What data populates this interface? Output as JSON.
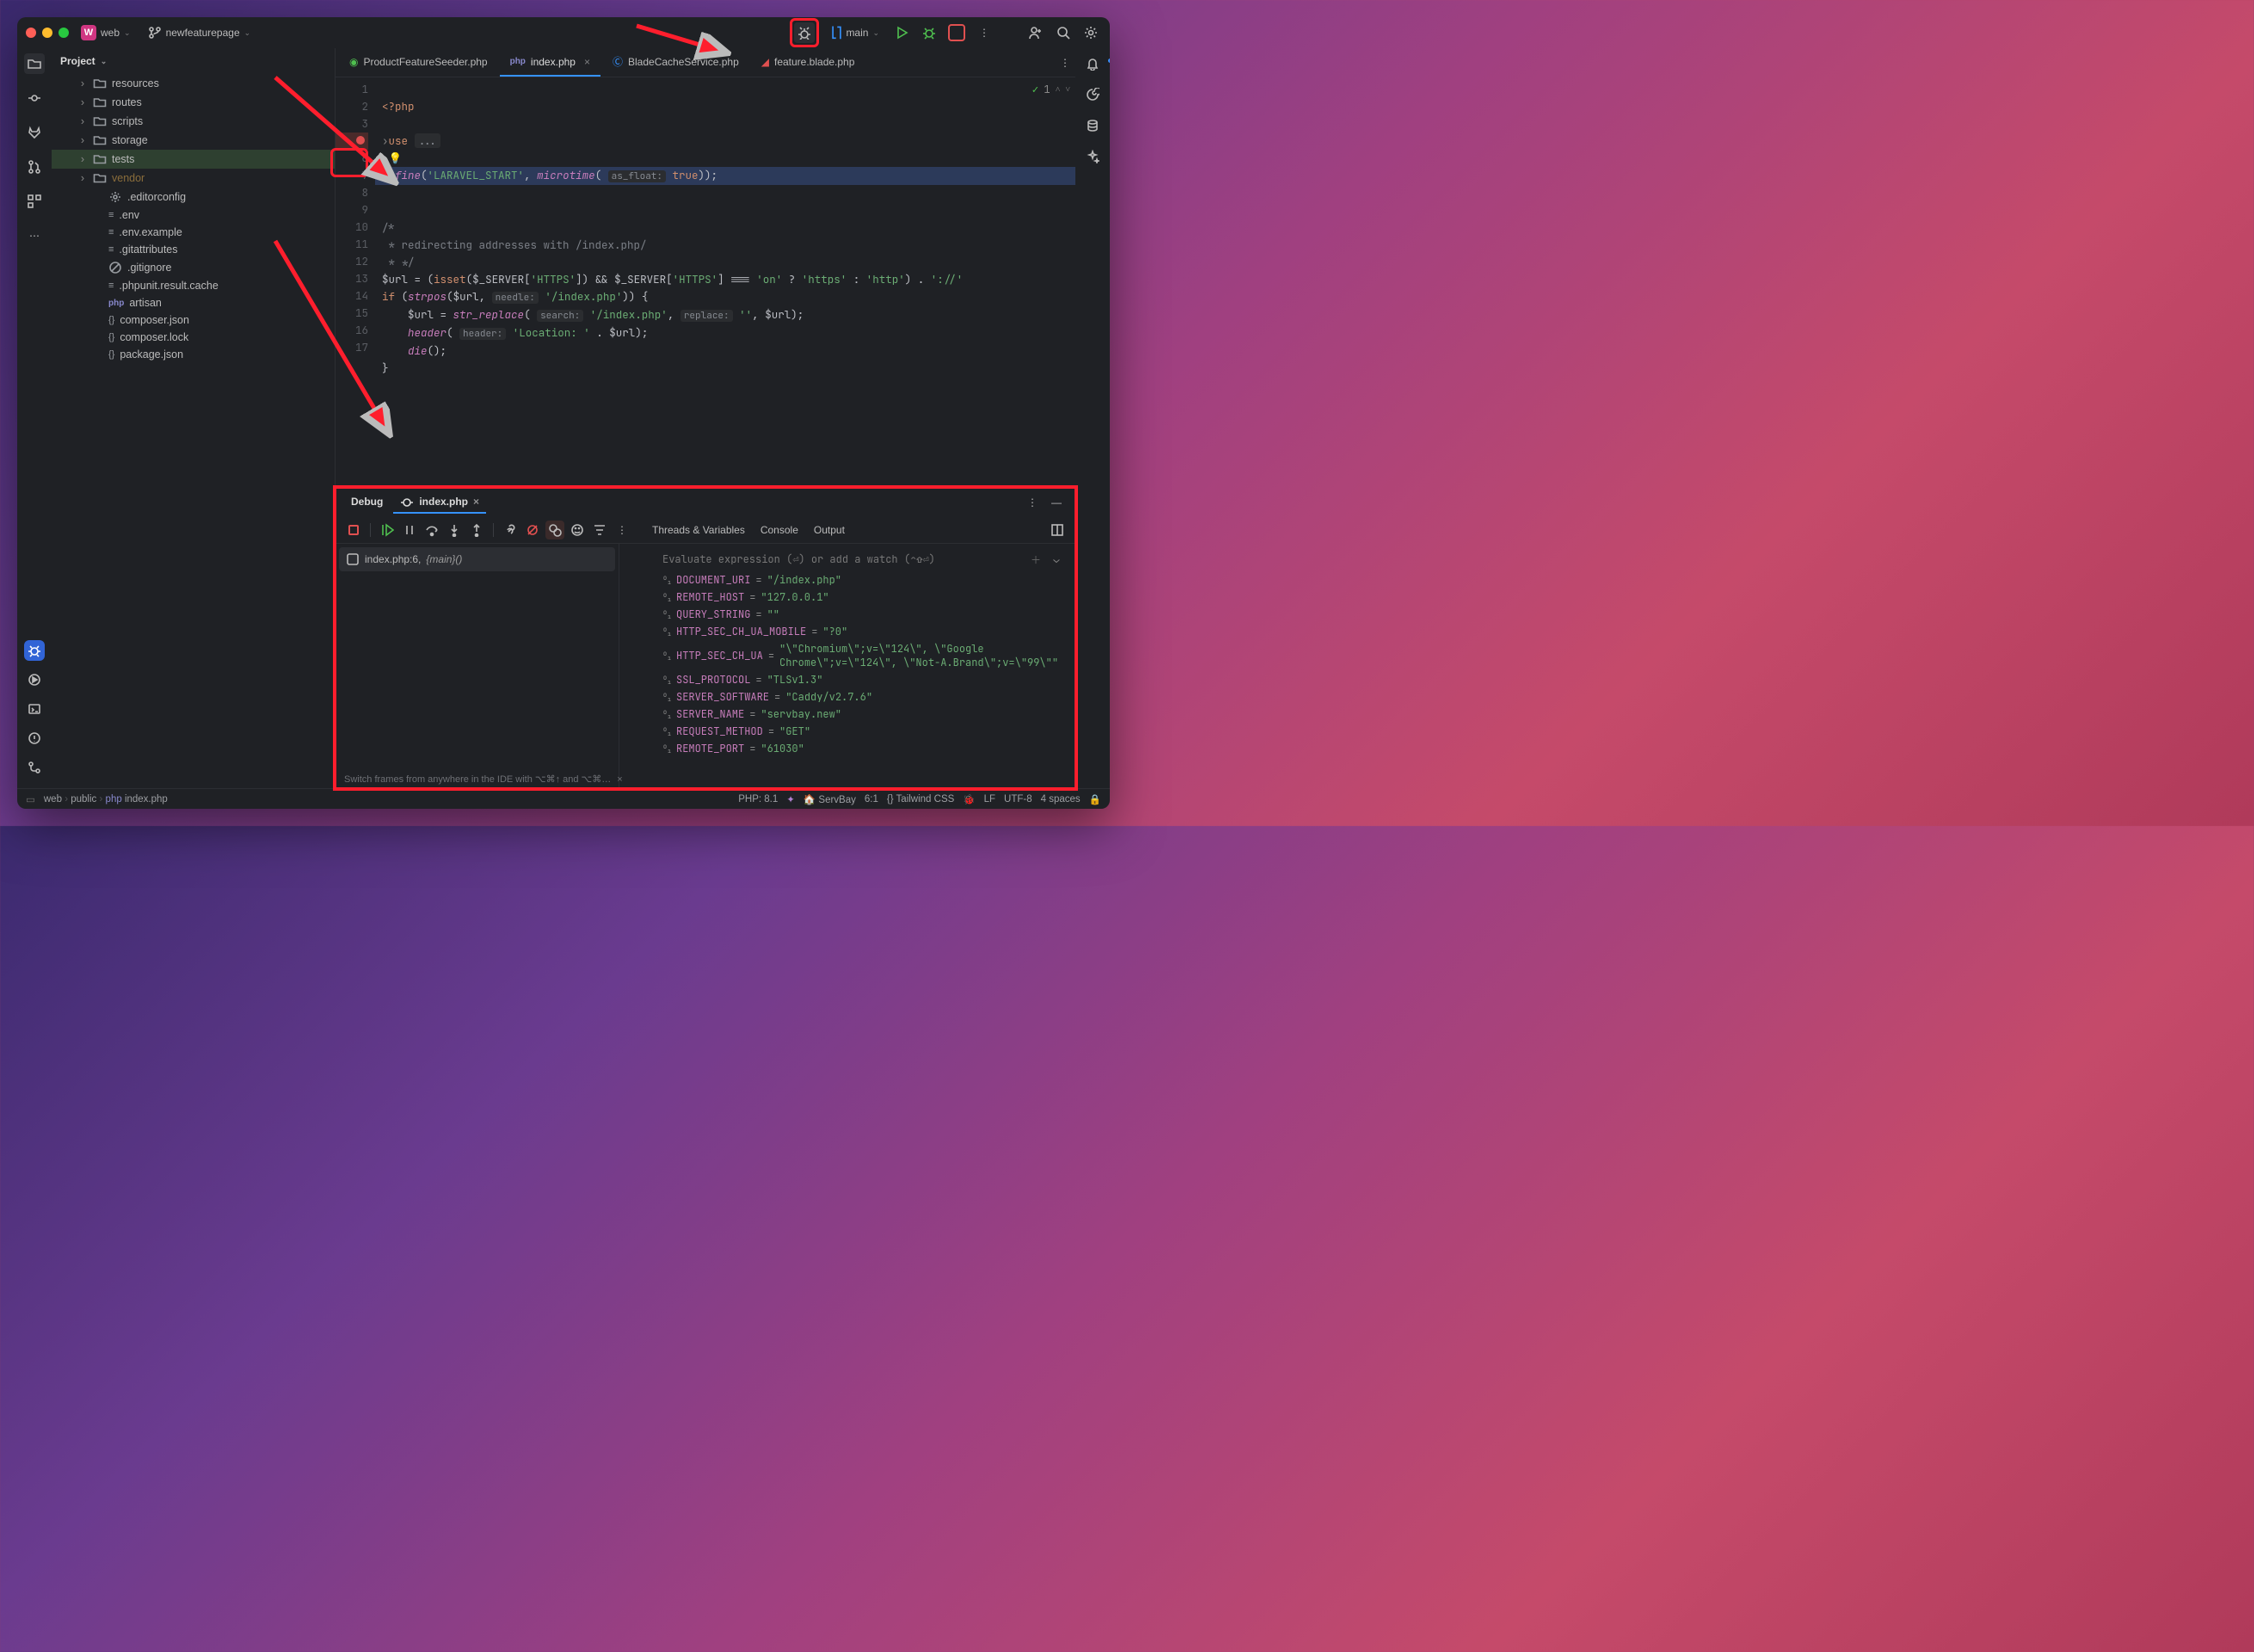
{
  "titlebar": {
    "project_name": "web",
    "branch": "newfeaturepage",
    "run_target": "main",
    "traffic": {
      "close": "#ff5f57",
      "min": "#febc2e",
      "max": "#28c840"
    }
  },
  "project_panel_title": "Project",
  "tree": [
    {
      "pad": 30,
      "arrow": "›",
      "icon": "folder",
      "label": "resources"
    },
    {
      "pad": 30,
      "arrow": "›",
      "icon": "folder",
      "label": "routes"
    },
    {
      "pad": 30,
      "arrow": "›",
      "icon": "folder",
      "label": "scripts"
    },
    {
      "pad": 30,
      "arrow": "›",
      "icon": "folder",
      "label": "storage"
    },
    {
      "pad": 30,
      "arrow": "›",
      "icon": "folder",
      "label": "tests",
      "selected": true
    },
    {
      "pad": 30,
      "arrow": "›",
      "icon": "folder",
      "label": "vendor",
      "dim": true
    },
    {
      "pad": 48,
      "arrow": "",
      "icon": "gear",
      "label": ".editorconfig"
    },
    {
      "pad": 48,
      "arrow": "",
      "icon": "equals",
      "label": ".env"
    },
    {
      "pad": 48,
      "arrow": "",
      "icon": "equals",
      "label": ".env.example"
    },
    {
      "pad": 48,
      "arrow": "",
      "icon": "equals",
      "label": ".gitattributes"
    },
    {
      "pad": 48,
      "arrow": "",
      "icon": "ignore",
      "label": ".gitignore"
    },
    {
      "pad": 48,
      "arrow": "",
      "icon": "equals",
      "label": ".phpunit.result.cache"
    },
    {
      "pad": 48,
      "arrow": "",
      "icon": "php",
      "label": "artisan"
    },
    {
      "pad": 48,
      "arrow": "",
      "icon": "json",
      "label": "composer.json"
    },
    {
      "pad": 48,
      "arrow": "",
      "icon": "json",
      "label": "composer.lock"
    },
    {
      "pad": 48,
      "arrow": "",
      "icon": "json",
      "label": "package.json"
    }
  ],
  "editor_tabs": [
    {
      "label": "ProductFeatureSeeder.php",
      "icon": "seed",
      "active": false,
      "close": false
    },
    {
      "label": "index.php",
      "icon": "php",
      "active": true,
      "close": true
    },
    {
      "label": "BladeCacheService.php",
      "icon": "class",
      "active": false,
      "close": false
    },
    {
      "label": "feature.blade.php",
      "icon": "blade",
      "active": false,
      "close": false
    }
  ],
  "editor_topright_warn": "1",
  "lines": [
    "1",
    "2",
    "3",
    "5",
    "6",
    "7",
    "8",
    "9",
    "10",
    "11",
    "12",
    "13",
    "14",
    "15",
    "16",
    "17"
  ],
  "breakpoint_line_index": 3,
  "code": {
    "l1": "<?php",
    "l3_kw": "use",
    "fold": "...",
    "bulb_line": 4,
    "l6_def": "define",
    "l6_str1": "'LARAVEL_START'",
    "l6_fn": "microtime",
    "l6_hint": "as_float:",
    "l6_true": "true",
    "c1": "/*",
    "c2": " * redirecting addresses with /index.php/",
    "c3": " * */",
    "l11": "$url = (isset($_SERVER['HTTPS']) && $_SERVER['HTTPS'] === 'on' ? 'https' : 'http') . '://'",
    "l12a": "if (strpos($url, ",
    "l12hint": "needle:",
    "l12b": " '/index.php')) {",
    "l13a": "    $url = str_replace( ",
    "l13h1": "search:",
    "l13b": " '/index.php', ",
    "l13h2": "replace:",
    "l13c": " '', $url);",
    "l14a": "    header( ",
    "l14h": "header:",
    "l14b": " 'Location: ' . $url);",
    "l15": "    die();",
    "l16": "}"
  },
  "debug": {
    "panel_title": "Debug",
    "session_tab": "index.php",
    "inner_tabs": [
      "Threads & Variables",
      "Console",
      "Output"
    ],
    "active_inner": 0,
    "frame": {
      "file": "index.php:6,",
      "fn": "{main}()"
    },
    "watch_placeholder": "Evaluate expression (⏎) or add a watch (⌃⇧⏎)",
    "vars": [
      {
        "k": "DOCUMENT_URI",
        "v": "\"/index.php\""
      },
      {
        "k": "REMOTE_HOST",
        "v": "\"127.0.0.1\""
      },
      {
        "k": "QUERY_STRING",
        "v": "\"\""
      },
      {
        "k": "HTTP_SEC_CH_UA_MOBILE",
        "v": "\"?0\""
      },
      {
        "k": "HTTP_SEC_CH_UA",
        "v": "\"\\\"Chromium\\\";v=\\\"124\\\", \\\"Google Chrome\\\";v=\\\"124\\\", \\\"Not-A.Brand\\\";v=\\\"99\\\"\""
      },
      {
        "k": "SSL_PROTOCOL",
        "v": "\"TLSv1.3\""
      },
      {
        "k": "SERVER_SOFTWARE",
        "v": "\"Caddy/v2.7.6\""
      },
      {
        "k": "SERVER_NAME",
        "v": "\"servbay.new\""
      },
      {
        "k": "REQUEST_METHOD",
        "v": "\"GET\""
      },
      {
        "k": "REMOTE_PORT",
        "v": "\"61030\""
      }
    ],
    "tip": "Switch frames from anywhere in the IDE with ⌥⌘↑ and ⌥⌘…"
  },
  "statusbar": {
    "crumbs": [
      "web",
      "public",
      "index.php"
    ],
    "php": "PHP: 8.1",
    "host": "ServBay",
    "pos": "6:1",
    "tailwind": "Tailwind CSS",
    "le": "LF",
    "enc": "UTF-8",
    "indent": "4 spaces"
  }
}
